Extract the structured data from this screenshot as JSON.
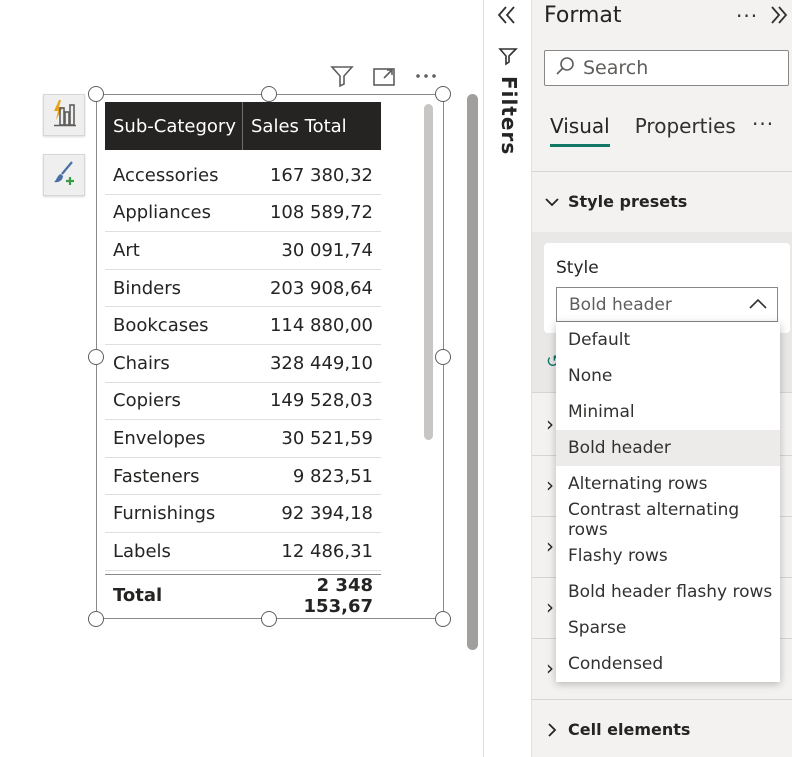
{
  "visual": {
    "header_icons": [
      "filter-icon",
      "focus-mode-icon",
      "more-options-icon"
    ],
    "more_label": "···"
  },
  "side_buttons": [
    "smart-visual-icon",
    "format-brush-icon"
  ],
  "table": {
    "headers": [
      "Sub-Category",
      "Sales Total"
    ],
    "rows": [
      [
        "Accessories",
        "167 380,32"
      ],
      [
        "Appliances",
        "108 589,72"
      ],
      [
        "Art",
        "30 091,74"
      ],
      [
        "Binders",
        "203 908,64"
      ],
      [
        "Bookcases",
        "114 880,00"
      ],
      [
        "Chairs",
        "328 449,10"
      ],
      [
        "Copiers",
        "149 528,03"
      ],
      [
        "Envelopes",
        "30 521,59"
      ],
      [
        "Fasteners",
        "9 823,51"
      ],
      [
        "Furnishings",
        "92 394,18"
      ],
      [
        "Labels",
        "12 486,31"
      ]
    ],
    "total": [
      "Total",
      "2 348 153,67"
    ]
  },
  "filters": {
    "label": "Filters",
    "collapse_icon": "double-chevron-left-icon"
  },
  "format_pane": {
    "title": "Format",
    "more_label": "···",
    "expand_icon": "double-chevron-right-icon",
    "search_placeholder": "Search",
    "tabs": [
      {
        "label": "Visual",
        "active": true
      },
      {
        "label": "Properties",
        "active": false
      }
    ],
    "tabs_more": "···",
    "sections": {
      "style_presets": "Style presets",
      "cell_elements": "Cell elements"
    },
    "style": {
      "label": "Style",
      "selected": "Bold header",
      "options": [
        "Default",
        "None",
        "Minimal",
        "Bold header",
        "Alternating rows",
        "Contrast alternating rows",
        "Flashy rows",
        "Bold header flashy rows",
        "Sparse",
        "Condensed"
      ]
    }
  },
  "colors": {
    "accent": "#117865",
    "header_bg": "#252423",
    "pane_bg": "#f3f2f1"
  }
}
